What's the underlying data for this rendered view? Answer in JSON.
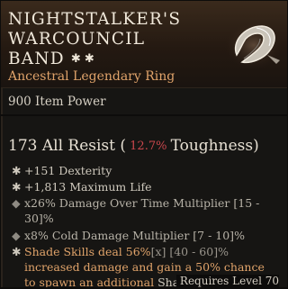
{
  "item": {
    "name_lines": [
      "NIGHTSTALKER'S",
      "WARCOUNCIL",
      "BAND"
    ],
    "stars": "✱ ✱",
    "type": "Ancestral Legendary Ring",
    "item_power": "900 Item Power"
  },
  "implicit": {
    "prefix": "173 All Resist (",
    "range": " 12.7% ",
    "suffix": "Toughness)"
  },
  "affixes": [
    {
      "bullet": "✱",
      "text": "+151 Dexterity"
    },
    {
      "bullet": "✱",
      "text": "+1,813 Maximum Life"
    },
    {
      "bullet": "◆",
      "line1": "x26% Damage Over Time Multiplier [15 -",
      "line2": "30]%"
    },
    {
      "bullet": "◆",
      "text": "x8% Cold Damage Multiplier [7 - 10]%"
    }
  ],
  "aspect": {
    "bullet": "✱",
    "line1_a": "Shade Skills deal ",
    "line1_b": "56%",
    "line1_c": "[x] [40 - 60]%",
    "line2": "increased damage and gain a 50% chance",
    "line3_a": "to spawn an additional ",
    "line3_b": "Shade",
    "line3_c": "."
  },
  "requires": "Requires Level 70",
  "colors": {
    "legendary_orange": "#e0a36a",
    "implicit_range_red": "#c8464c",
    "text_light": "#d9d4c8"
  },
  "icons": {
    "item_icon": "ring-icon"
  }
}
